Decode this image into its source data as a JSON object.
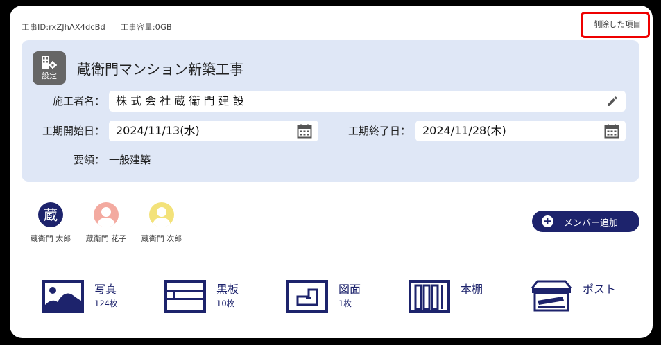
{
  "meta": {
    "project_id": "工事ID:rxZJhAX4dcBd",
    "capacity": "工事容量:0GB",
    "deleted_link": "削除した項目"
  },
  "project": {
    "settings_label": "設定",
    "title": "蔵衛門マンション新築工事",
    "contractor_label": "施工者名：",
    "contractor_value": "株 式 会 社 蔵 衛 門 建 設",
    "start_label": "工期開始日：",
    "start_value": "2024/11/13(水)",
    "end_label": "工期終了日：",
    "end_value": "2024/11/28(木)",
    "summary_label": "要領：",
    "summary_value": "一般建築"
  },
  "members": [
    {
      "name": "蔵衛門 太郎",
      "avatar_char": "蔵",
      "color": "#1d236c"
    },
    {
      "name": "蔵衛門 花子",
      "color": "#f3aaa0"
    },
    {
      "name": "蔵衛門 次郎",
      "color": "#f3e27a"
    }
  ],
  "add_member_label": "メンバー追加",
  "tools": [
    {
      "name": "写真",
      "count": "124枚",
      "icon": "photo-icon"
    },
    {
      "name": "黒板",
      "count": "10枚",
      "icon": "blackboard-icon"
    },
    {
      "name": "図面",
      "count": "1枚",
      "icon": "floorplan-icon"
    },
    {
      "name": "本棚",
      "icon": "bookshelf-icon"
    },
    {
      "name": "ポスト",
      "icon": "post-tray-icon"
    }
  ],
  "colors": {
    "navy": "#1d236c",
    "panel": "#dfe7f6",
    "highlight": "#e00000"
  }
}
